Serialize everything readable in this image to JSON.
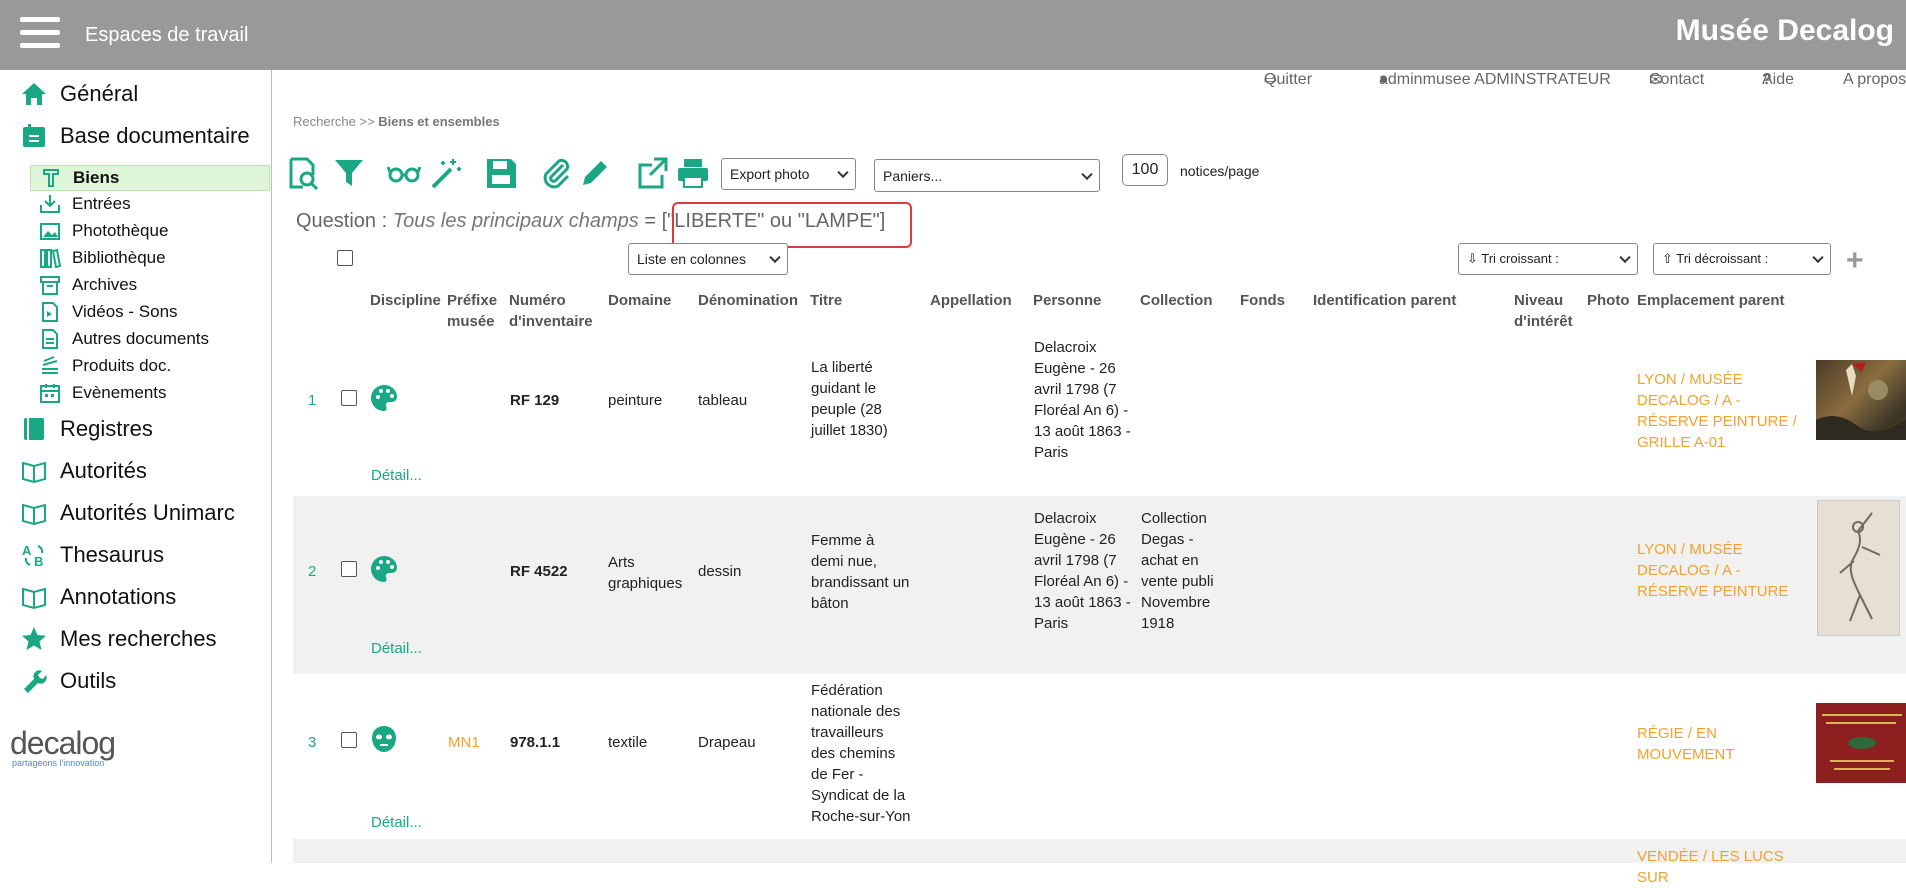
{
  "header": {
    "workspaces": "Espaces de travail",
    "brand": "Musée Decalog"
  },
  "sidebar": {
    "main": [
      {
        "label": "Général"
      },
      {
        "label": "Base documentaire"
      }
    ],
    "subs": [
      {
        "label": "Biens"
      },
      {
        "label": "Entrées"
      },
      {
        "label": "Photothèque"
      },
      {
        "label": "Bibliothèque"
      },
      {
        "label": "Archives"
      },
      {
        "label": "Vidéos - Sons"
      },
      {
        "label": "Autres documents"
      },
      {
        "label": "Produits doc."
      },
      {
        "label": "Evènements"
      }
    ],
    "more": [
      {
        "label": "Registres"
      },
      {
        "label": "Autorités"
      },
      {
        "label": "Autorités Unimarc"
      },
      {
        "label": "Thesaurus"
      },
      {
        "label": "Annotations"
      },
      {
        "label": "Mes recherches"
      },
      {
        "label": "Outils"
      }
    ],
    "logo": {
      "text": "decalog",
      "tagline": "partageons l'innovation"
    }
  },
  "toplinks": {
    "quit": "Quitter",
    "user": "adminmusee ADMINSTRATEUR",
    "contact": "Contact",
    "help": "Aide",
    "about": "A propos"
  },
  "breadcrumb": {
    "root": "Recherche >>",
    "current": "Biens et ensembles"
  },
  "toolbar": {
    "export": "Export photo",
    "baskets": "Paniers...",
    "per_page": "100",
    "per_page_label": "notices/page"
  },
  "question": {
    "label": "Question :",
    "field": "Tous les principaux champs",
    "op": "=",
    "value": "[\"LIBERTE\" ou \"LAMPE\"]"
  },
  "view_select": "Liste en colonnes",
  "sort": {
    "asc": "⇩ Tri croissant :",
    "desc": "⇧ Tri décroissant :"
  },
  "columns": {
    "discipline": "Discipline",
    "prefix": "Préfixe musée",
    "inventory": "Numéro d'inventaire",
    "domain": "Domaine",
    "denomination": "Dénomination",
    "title": "Titre",
    "appellation": "Appellation",
    "person": "Personne",
    "collection": "Collection",
    "fonds": "Fonds",
    "parent_id": "Identification parent",
    "interest": "Niveau d'intérêt",
    "photo": "Photo",
    "location": "Emplacement parent"
  },
  "detail_label": "Détail...",
  "rows": [
    {
      "n": "1",
      "prefix": "",
      "inv": "RF 129",
      "domain": "peinture",
      "denom": "tableau",
      "title": "La liberté guidant le peuple (28 juillet 1830)",
      "person": "Delacroix Eugène - 26 avril 1798 (7 Floréal An 6) - 13 août 1863 - Paris",
      "collection": "",
      "location": "LYON / MUSÉE DECALOG / A - RÉSERVE PEINTURE / GRILLE A-01"
    },
    {
      "n": "2",
      "prefix": "",
      "inv": "RF 4522",
      "domain": "Arts graphiques",
      "denom": "dessin",
      "title": "Femme à demi nue, brandissant un bâton",
      "person": "Delacroix Eugène - 26 avril 1798 (7 Floréal An 6) - 13 août 1863 - Paris",
      "collection": "Collection Degas - achat en vente publi Novembre 1918",
      "location": "LYON / MUSÉE DECALOG / A - RÉSERVE PEINTURE"
    },
    {
      "n": "3",
      "prefix": "MN1",
      "inv": "978.1.1",
      "domain": "textile",
      "denom": "Drapeau",
      "title": "Fédération nationale des travailleurs des chemins de Fer - Syndicat de la Roche-sur-Yon",
      "person": "",
      "collection": "",
      "location": "RÉGIE / EN MOUVEMENT"
    },
    {
      "location": "VENDÉE / LES LUCS SUR"
    }
  ],
  "colors": {
    "accent": "#19a784",
    "location": "#f0a22e",
    "header": "#999999",
    "highlight": "#d93a3a"
  }
}
